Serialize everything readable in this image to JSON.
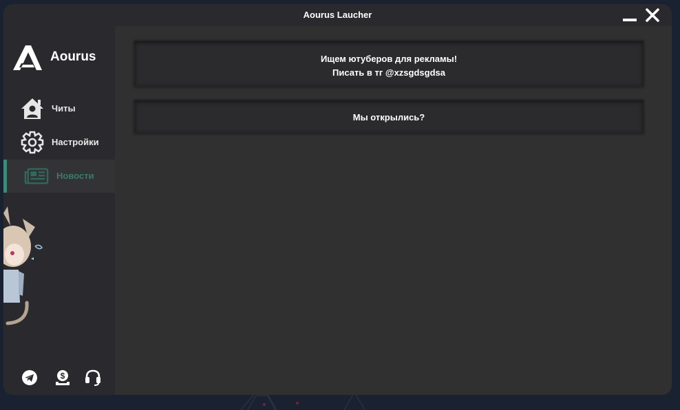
{
  "window": {
    "title": "Aourus Laucher",
    "minimize_icon": "minimize-icon",
    "close_icon": "close-icon"
  },
  "sidebar": {
    "logo_text": "Aourus",
    "items": [
      {
        "label": "Читы",
        "icon": "home-user-icon",
        "active": false
      },
      {
        "label": "Настройки",
        "icon": "gear-icon",
        "active": false
      },
      {
        "label": "Новости",
        "icon": "newspaper-icon",
        "active": true
      }
    ],
    "footer_icons": [
      "telegram-icon",
      "donate-icon",
      "support-headset-icon"
    ]
  },
  "news": [
    {
      "lines": [
        "Ищем ютуберов для рекламы!",
        "Писать в тг @xzsgdsgdsa"
      ]
    },
    {
      "lines": [
        "Мы открылись?"
      ]
    }
  ],
  "colors": {
    "window_bg": "#2a2a2e",
    "content_bg": "#303030",
    "card_bg": "#2b2b2e",
    "accent": "#3d8c78",
    "text": "#ffffff"
  }
}
